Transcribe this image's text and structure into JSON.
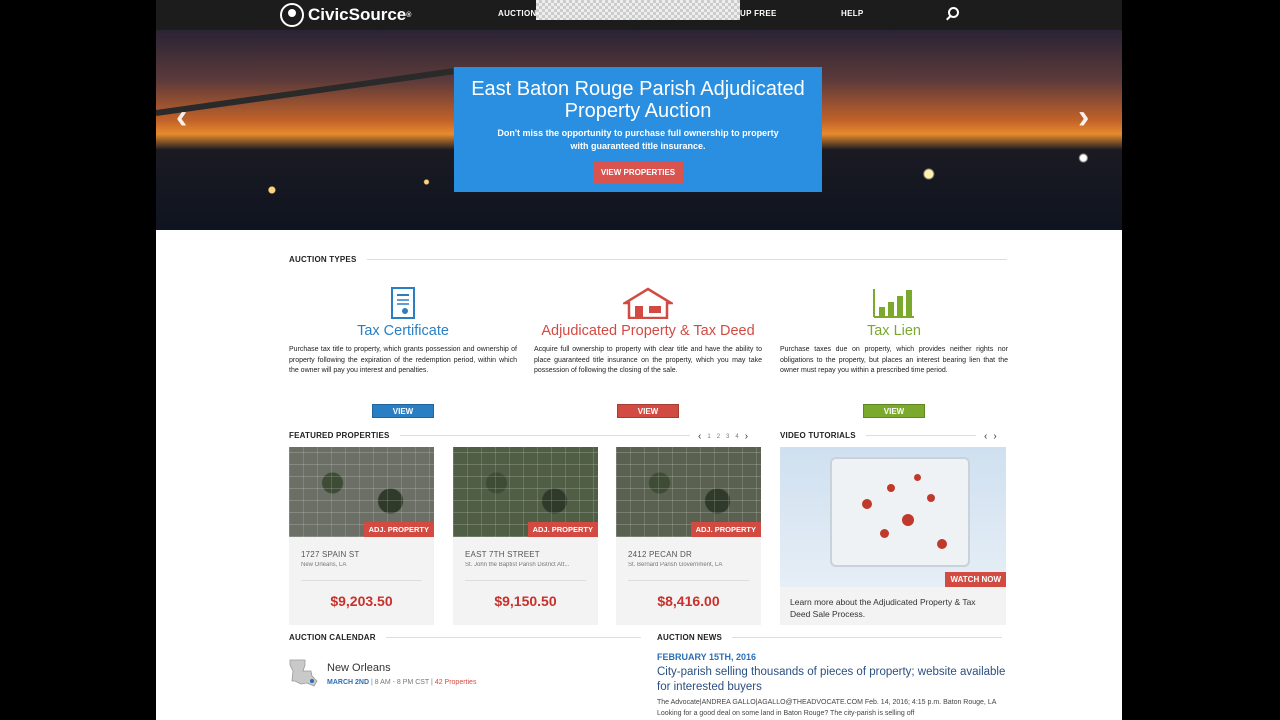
{
  "nav": {
    "brand": "CivicSource",
    "brand_mark": "®",
    "links": {
      "auctions": "AUCTIONS",
      "signup": "UP FREE",
      "help": "HELP"
    }
  },
  "hero": {
    "title": "East Baton Rouge Parish Adjudicated Property Auction",
    "subtitle": "Don't miss the opportunity to purchase full ownership to property with guaranteed title insurance.",
    "button": "VIEW PROPERTIES",
    "prev": "‹",
    "next": "›"
  },
  "auction_types": {
    "heading": "AUCTION TYPES",
    "items": [
      {
        "title": "Tax Certificate",
        "color": "#2a7fc4",
        "button": "VIEW",
        "icon": "certificate-icon",
        "text": "Purchase tax title to property, which grants possession and ownership of property following the expiration of the redemption period, within which the owner will pay you interest and penalties."
      },
      {
        "title": "Adjudicated Property & Tax Deed",
        "color": "#d14b43",
        "button": "VIEW",
        "icon": "house-icon",
        "text": "Acquire full ownership to property with clear title and have the ability to place guaranteed title insurance on the property, which you may take possession of following the closing of the sale."
      },
      {
        "title": "Tax Lien",
        "color": "#7aa92e",
        "button": "VIEW",
        "icon": "bar-chart-icon",
        "text": "Purchase taxes due on property, which provides neither rights nor obligations to the property, but places an interest bearing lien that the owner must repay you within a prescribed time period."
      }
    ]
  },
  "featured": {
    "heading": "FEATURED PROPERTIES",
    "pages": [
      "1",
      "2",
      "3",
      "4"
    ],
    "prev": "‹",
    "next": "›",
    "properties": [
      {
        "tag": "ADJ. PROPERTY",
        "address": "1727 SPAIN ST",
        "location": "New Orleans, LA",
        "price": "$9,203.50"
      },
      {
        "tag": "ADJ. PROPERTY",
        "address": "EAST 7TH STREET",
        "location": "St. John the Baptist Parish District Att...",
        "price": "$9,150.50"
      },
      {
        "tag": "ADJ. PROPERTY",
        "address": "2412 PECAN DR",
        "location": "St. Bernard Parish Government, LA",
        "price": "$8,416.00"
      }
    ]
  },
  "video": {
    "heading": "VIDEO TUTORIALS",
    "prev": "‹",
    "next": "›",
    "button": "WATCH NOW",
    "text": "Learn more about the Adjudicated Property & Tax Deed Sale Process."
  },
  "calendar": {
    "heading": "AUCTION CALENDAR",
    "city": "New Orleans",
    "date": "MARCH 2ND",
    "time": "8 AM - 8 PM CST",
    "properties": "42 Properties",
    "sep": "|"
  },
  "news": {
    "heading": "AUCTION NEWS",
    "date": "FEBRUARY 15TH, 2016",
    "title": "City-parish selling thousands of pieces of property; website available for interested buyers",
    "body": "The Advocate|ANDREA GALLO|AGALLO@THEADVOCATE.COM Feb. 14, 2016; 4:15 p.m. Baton Rouge, LA Looking for a good deal on some land in Baton Rouge? The city-parish is selling off"
  }
}
